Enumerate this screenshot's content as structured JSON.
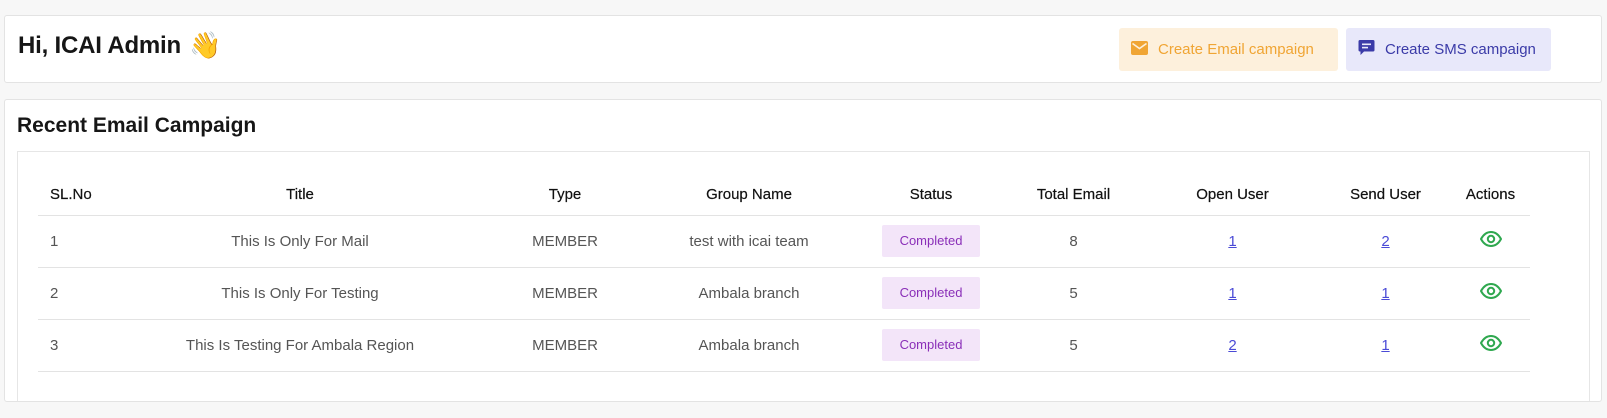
{
  "header": {
    "greeting": "Hi, ICAI Admin",
    "wave_emoji": "👋",
    "email_button_label": "Create Email campaign",
    "sms_button_label": "Create SMS campaign",
    "colors": {
      "email_accent": "#f0a534",
      "sms_accent": "#3b3ba8"
    }
  },
  "campaigns": {
    "title": "Recent Email Campaign",
    "columns": [
      "SL.No",
      "Title",
      "Type",
      "Group Name",
      "Status",
      "Total Email",
      "Open User",
      "Send User",
      "Actions"
    ],
    "rows": [
      {
        "sl": "1",
        "title": "This Is Only For Mail",
        "type": "MEMBER",
        "group": "test with icai team",
        "status": "Completed",
        "total": "8",
        "open": "1",
        "send": "2",
        "action_icon": "eye-icon"
      },
      {
        "sl": "2",
        "title": "This Is Only For Testing",
        "type": "MEMBER",
        "group": "Ambala branch",
        "status": "Completed",
        "total": "5",
        "open": "1",
        "send": "1",
        "action_icon": "eye-icon"
      },
      {
        "sl": "3",
        "title": "This Is Testing For Ambala Region",
        "type": "MEMBER",
        "group": "Ambala branch",
        "status": "Completed",
        "total": "5",
        "open": "2",
        "send": "1",
        "action_icon": "eye-icon"
      }
    ]
  }
}
